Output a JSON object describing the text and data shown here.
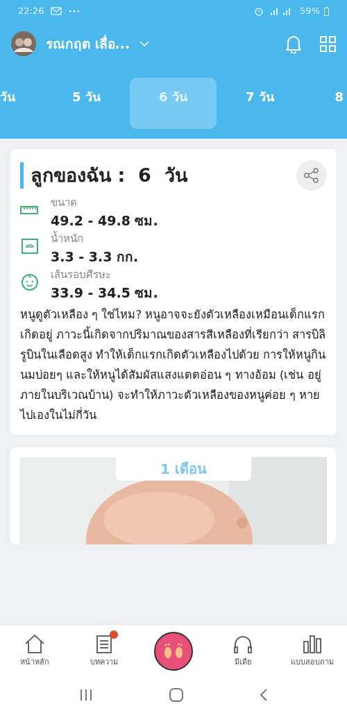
{
  "status_bar": {
    "time": "22:26",
    "battery": "59%"
  },
  "header": {
    "profile_name": "รณกฤต เลื่อ..."
  },
  "tabs": [
    {
      "label": "วัน",
      "selected": false
    },
    {
      "label": "5 วัน",
      "selected": false
    },
    {
      "label": "6 วัน",
      "selected": true
    },
    {
      "label": "7 วัน",
      "selected": false
    },
    {
      "label": "8",
      "selected": false
    }
  ],
  "card": {
    "title": "ลูกของฉัน :  6  วัน",
    "metrics": [
      {
        "kind": "length",
        "label": "ขนาด",
        "value": "49.2 - 49.8 ซม."
      },
      {
        "kind": "weight",
        "label": "น้ำหนัก",
        "value": "3.3 - 3.3 กก."
      },
      {
        "kind": "head",
        "label": "เส้นรอบศีรษะ",
        "value": "33.9 - 34.5 ซม."
      }
    ],
    "description": "หนูดูตัวเหลือง ๆ ใช่ไหม? หนูอาจจะยังตัวเหลืองเหมือนเด็กแรกเกิดอยู่ ภาวะนี้เกิดจากปริมาณของสารสีเหลืองที่เรียกว่า สารบิลิรูบินในเลือดสูง ทำให้เด็กแรกเกิดตัวเหลืองไปด้วย การให้หนูกินนมบ่อยๆ และให้หนูได้สัมผัสแสงแดดอ่อน ๆ ทางอ้อม (เช่น อยู่ภายในบริเวณบ้าน) จะทำให้ภาวะตัวเหลืองของหนูค่อย ๆ หายไปเองในไม่กี่วัน"
  },
  "next_card": {
    "label": "1 เดือน"
  },
  "bottom_nav": [
    {
      "kind": "home",
      "label": "หน้าหลัก",
      "badge": false
    },
    {
      "kind": "article",
      "label": "บทความ",
      "badge": true
    },
    {
      "kind": "center"
    },
    {
      "kind": "media",
      "label": "มีเดีย",
      "badge": false
    },
    {
      "kind": "survey",
      "label": "แบบสอบถาม",
      "badge": false
    }
  ]
}
